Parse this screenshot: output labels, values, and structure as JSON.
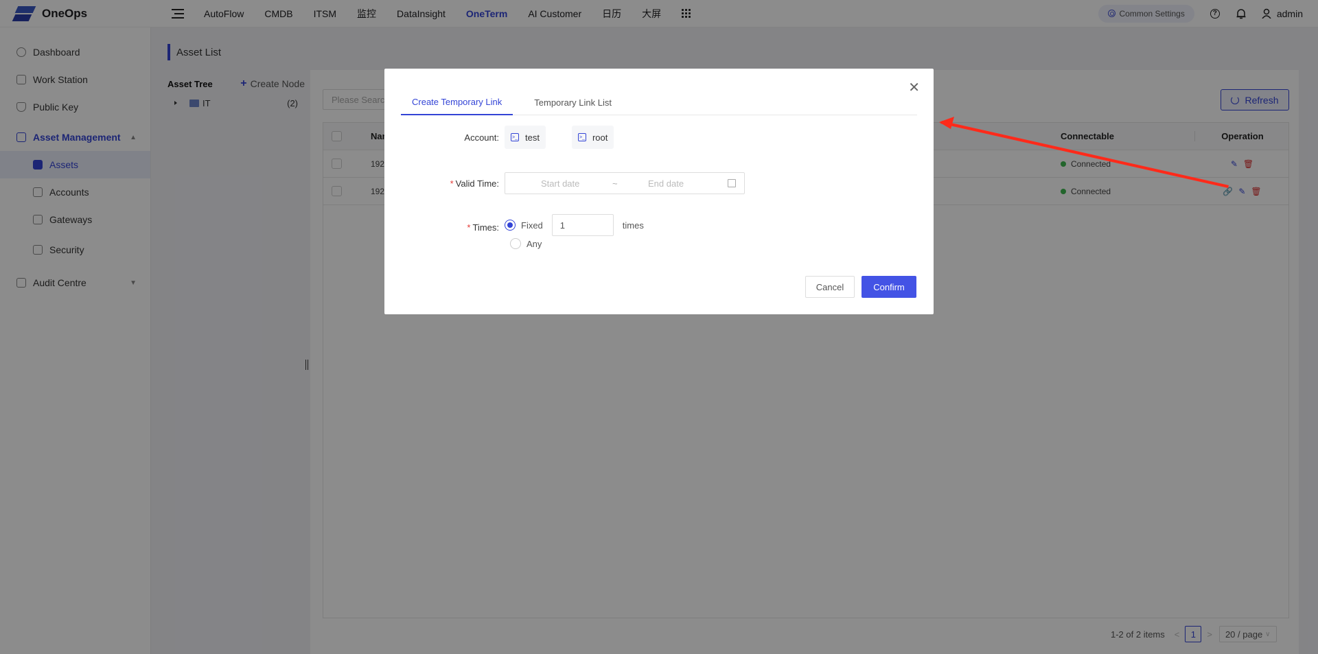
{
  "app": {
    "name": "OneOps"
  },
  "topnav": {
    "items": [
      {
        "label": "AutoFlow",
        "active": false
      },
      {
        "label": "CMDB",
        "active": false
      },
      {
        "label": "ITSM",
        "active": false
      },
      {
        "label": "监控",
        "active": false
      },
      {
        "label": "DataInsight",
        "active": false
      },
      {
        "label": "OneTerm",
        "active": true
      },
      {
        "label": "AI Customer",
        "active": false
      },
      {
        "label": "日历",
        "active": false
      },
      {
        "label": "大屏",
        "active": false
      }
    ],
    "common_settings": "Common Settings",
    "user": "admin"
  },
  "sidebar": {
    "items": [
      {
        "label": "Dashboard",
        "icon": "dashboard-icon"
      },
      {
        "label": "Work Station",
        "icon": "monitor-icon"
      },
      {
        "label": "Public Key",
        "icon": "shield-key-icon"
      }
    ],
    "group": {
      "label": "Asset Management",
      "expanded": true
    },
    "sub_items": [
      {
        "label": "Assets",
        "active": true
      },
      {
        "label": "Accounts",
        "active": false
      },
      {
        "label": "Gateways",
        "active": false
      },
      {
        "label": "Security",
        "active": false
      }
    ],
    "audit": {
      "label": "Audit Centre"
    }
  },
  "page": {
    "title": "Asset List",
    "tree": {
      "title": "Asset Tree",
      "create_node": "Create Node",
      "nodes": [
        {
          "label": "IT",
          "count": "(2)"
        }
      ]
    },
    "search_placeholder": "Please Search",
    "refresh_label": "Refresh",
    "table": {
      "headers": {
        "name": "Name",
        "connectable": "Connectable",
        "operation": "Operation"
      },
      "rows": [
        {
          "name": "192",
          "status": "Connected"
        },
        {
          "name": "192",
          "status": "Connected"
        }
      ]
    },
    "pagination": {
      "summary": "1-2 of 2 items",
      "current_page": "1",
      "page_size": "20 / page"
    }
  },
  "modal": {
    "tabs": [
      {
        "label": "Create Temporary Link",
        "active": true
      },
      {
        "label": "Temporary Link List",
        "active": false
      }
    ],
    "account_label": "Account:",
    "accounts": [
      "test",
      "root"
    ],
    "valid_time_label": "Valid Time:",
    "start_placeholder": "Start date",
    "range_sep": "~",
    "end_placeholder": "End date",
    "times_label": "Times:",
    "fixed_label": "Fixed",
    "fixed_value": "1",
    "times_suffix": "times",
    "any_label": "Any",
    "cancel_label": "Cancel",
    "confirm_label": "Confirm"
  },
  "annotation": {
    "arrow_color": "#ff2a1a"
  }
}
